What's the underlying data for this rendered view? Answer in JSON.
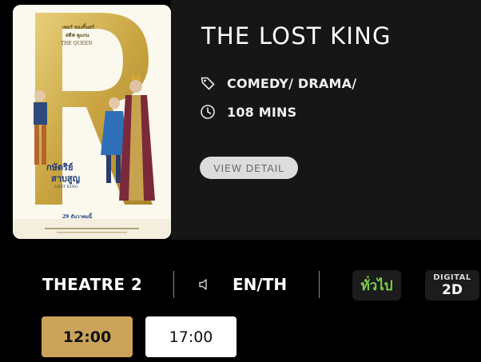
{
  "movie": {
    "title": "THE LOST KING",
    "genre": "COMEDY/ DRAMA/",
    "duration": "108 MINS",
    "detail_button": "VIEW DETAIL"
  },
  "poster": {
    "credit_line_1": "เพอร์ ชองกิ้นสร์",
    "credit_line_2": "สตีฟ คูแกน",
    "credit_line_3": "THE QUEEN",
    "thai_title_1": "กษัตริย์",
    "thai_title_2": "สาบสูญ",
    "english_small": "LOST KING",
    "release_date": "29 ธันวาคมนี้"
  },
  "showing": {
    "theatre": "THEATRE 2",
    "language": "EN/TH",
    "rating_badge": "ทั่วไป",
    "format_badge_top": "DIGITAL",
    "format_badge_bottom": "2D",
    "showtimes": [
      "12:00",
      "17:00"
    ]
  },
  "colors": {
    "accent_gold": "#cba35a",
    "rating_green": "#7cd24a",
    "info_panel": "#161616"
  },
  "icons": {
    "genre": "tag-icon",
    "duration": "clock-icon",
    "audio": "speaker-icon"
  }
}
